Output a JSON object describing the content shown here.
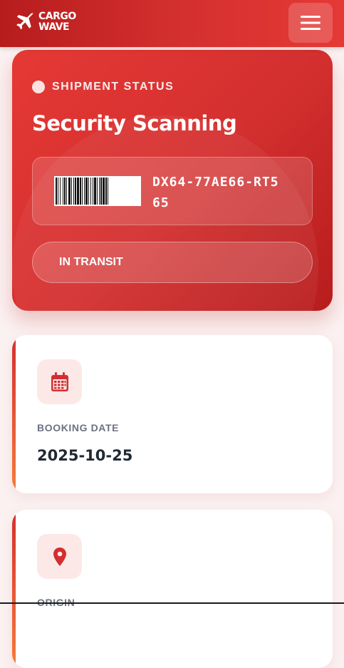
{
  "brand": {
    "name": "CARGO\nWAVE",
    "icon": "plane-icon"
  },
  "header": {
    "menu_icon": "hamburger-menu-icon"
  },
  "shipment": {
    "eyebrow": "SHIPMENT STATUS",
    "status": "Security Scanning",
    "tracking_code": "DX64-77AE66-RT565",
    "transit_label": "IN TRANSIT"
  },
  "details": [
    {
      "label": "BOOKING DATE",
      "value": "2025-10-25",
      "icon": "calendar-icon"
    },
    {
      "label": "ORIGIN",
      "value": "",
      "icon": "location-pin-icon"
    }
  ],
  "colors": {
    "primary": "#d32f2f",
    "primary_dark": "#b71c1c",
    "accent": "#f57c3a",
    "icon_bg": "#fde8e8",
    "page_bg": "#fbf1f1"
  }
}
